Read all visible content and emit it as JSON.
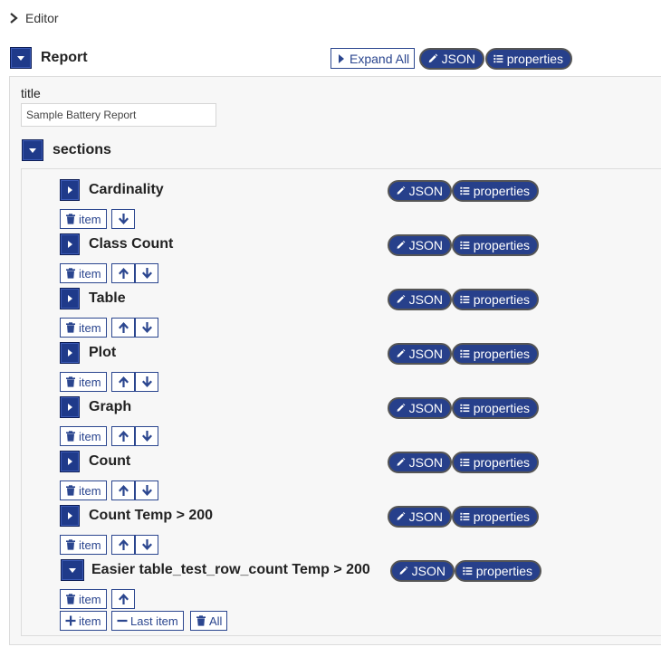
{
  "breadcrumb": {
    "label": "Editor"
  },
  "root": {
    "title": "Report",
    "expand_all_label": "Expand All",
    "json_label": "JSON",
    "properties_label": "properties"
  },
  "title_field": {
    "label": "title",
    "value": "Sample Battery Report"
  },
  "sections": {
    "label": "sections",
    "item_label": "item",
    "json_label": "JSON",
    "properties_label": "properties",
    "items": [
      {
        "title": "Cardinality",
        "expanded": false
      },
      {
        "title": "Class Count",
        "expanded": false
      },
      {
        "title": "Table",
        "expanded": false
      },
      {
        "title": "Plot",
        "expanded": false
      },
      {
        "title": "Graph",
        "expanded": false
      },
      {
        "title": "Count",
        "expanded": false
      },
      {
        "title": "Count Temp > 200",
        "expanded": false
      },
      {
        "title": "Easier table_test_row_count Temp > 200",
        "expanded": true
      }
    ],
    "add_item_label": "item",
    "remove_last_label": "Last item",
    "remove_all_label": "All"
  },
  "colors": {
    "accent": "#27408b",
    "toggle": "#1f3a8a",
    "panel_bg": "#f7f7f7",
    "border": "#dcdcdc"
  },
  "icons": {
    "breadcrumb": "chevron-right-icon",
    "edit": "pencil-icon",
    "properties": "list-icon",
    "delete": "trash-icon",
    "up": "arrow-up-icon",
    "down": "arrow-down-icon",
    "add": "plus-icon",
    "remove": "minus-icon"
  }
}
